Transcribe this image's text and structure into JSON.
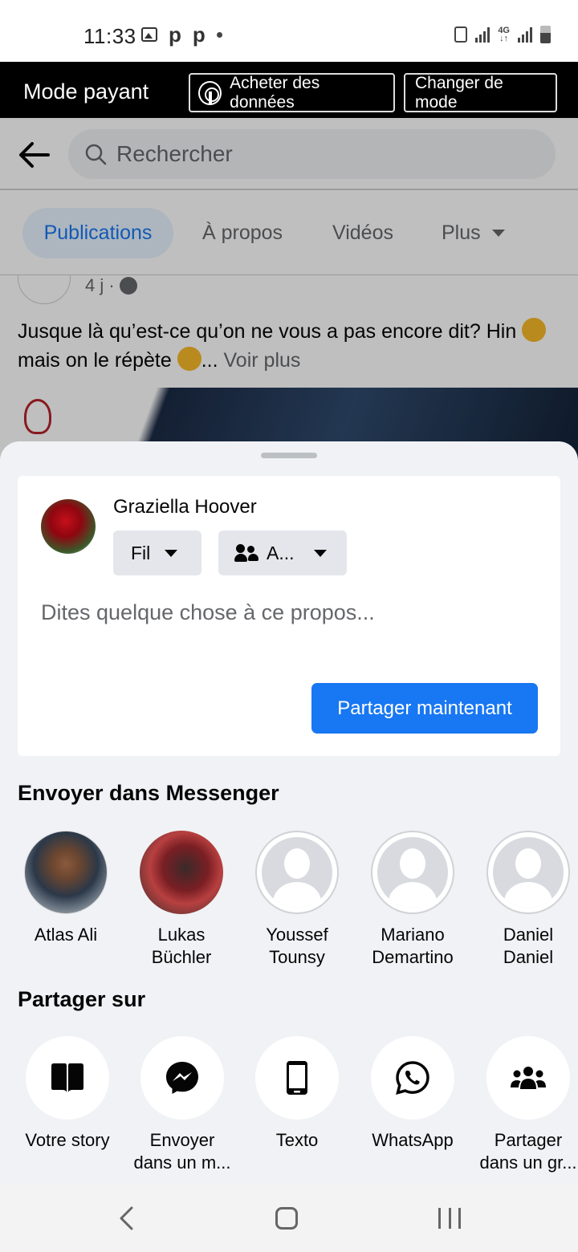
{
  "status_bar": {
    "time": "11:33"
  },
  "mode_bar": {
    "title": "Mode payant",
    "buy_label": "Acheter des données",
    "change_label": "Changer de mode"
  },
  "search": {
    "placeholder": "Rechercher"
  },
  "tabs": [
    {
      "label": "Publications",
      "active": true
    },
    {
      "label": "À propos"
    },
    {
      "label": "Vidéos"
    },
    {
      "label": "Plus"
    }
  ],
  "post": {
    "age": "4 j ·",
    "text_part1": "Jusque là qu’est-ce qu’on ne vous a pas encore dit? Hin ",
    "text_part2": "mais on le répète ",
    "ellipsis": "...",
    "more": "Voir plus"
  },
  "compose": {
    "user_name": "Graziella Hoover",
    "feed_label": "Fil",
    "audience_label": "A...",
    "placeholder": "Dites quelque chose à ce propos...",
    "share_now": "Partager maintenant"
  },
  "messenger": {
    "title": "Envoyer dans Messenger",
    "contacts": [
      {
        "line1": "Atlas Ali",
        "line2": ""
      },
      {
        "line1": "Lukas",
        "line2": "Büchler"
      },
      {
        "line1": "Youssef",
        "line2": "Tounsy"
      },
      {
        "line1": "Mariano",
        "line2": "Demartino"
      },
      {
        "line1": "Daniel",
        "line2": "Daniel"
      }
    ]
  },
  "share_on": {
    "title": "Partager sur",
    "targets": [
      {
        "line1": "Votre story",
        "line2": "",
        "icon": "book-open-icon"
      },
      {
        "line1": "Envoyer",
        "line2": "dans un m...",
        "icon": "messenger-icon"
      },
      {
        "line1": "Texto",
        "line2": "",
        "icon": "phone-icon"
      },
      {
        "line1": "WhatsApp",
        "line2": "",
        "icon": "whatsapp-icon"
      },
      {
        "line1": "Partager",
        "line2": "dans un gr...",
        "icon": "group-icon"
      }
    ]
  },
  "colors": {
    "accent": "#1877f2",
    "sheet_bg": "#f0f2f5",
    "mode_bar_bg": "#000000"
  }
}
